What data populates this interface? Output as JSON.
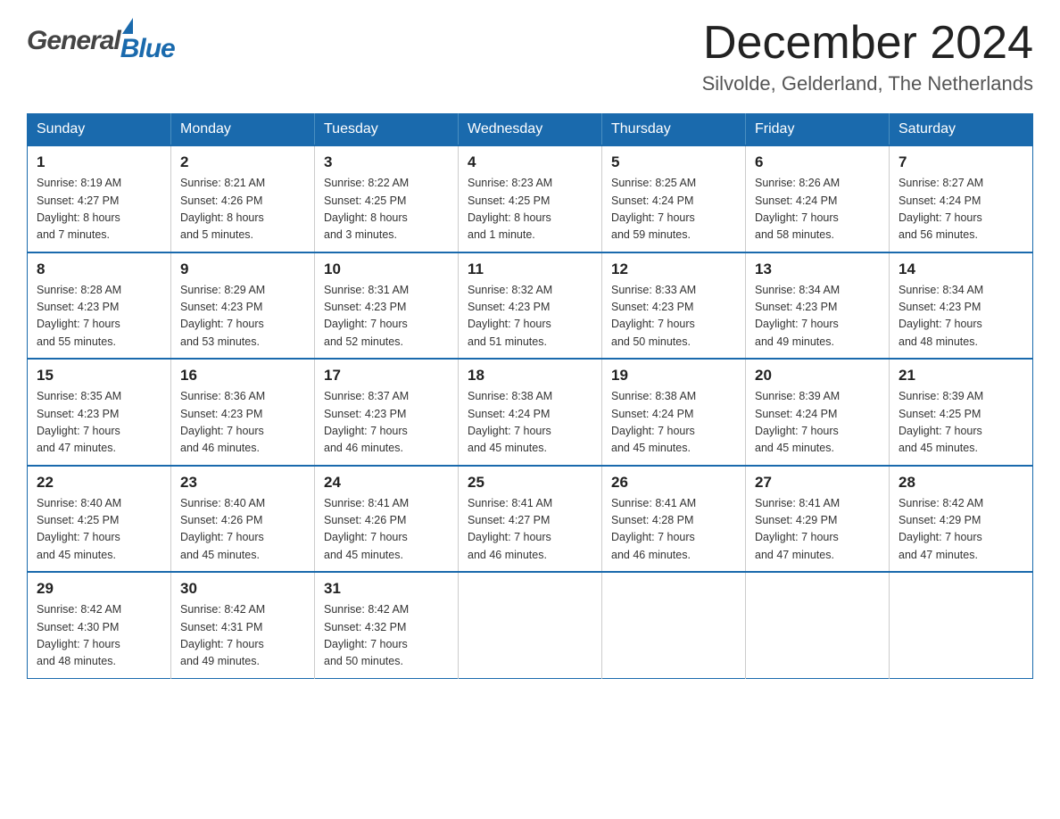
{
  "header": {
    "logo_general": "General",
    "logo_blue": "Blue",
    "month_title": "December 2024",
    "location": "Silvolde, Gelderland, The Netherlands"
  },
  "weekdays": [
    "Sunday",
    "Monday",
    "Tuesday",
    "Wednesday",
    "Thursday",
    "Friday",
    "Saturday"
  ],
  "weeks": [
    [
      {
        "day": "1",
        "sunrise": "8:19 AM",
        "sunset": "4:27 PM",
        "daylight": "8 hours and 7 minutes."
      },
      {
        "day": "2",
        "sunrise": "8:21 AM",
        "sunset": "4:26 PM",
        "daylight": "8 hours and 5 minutes."
      },
      {
        "day": "3",
        "sunrise": "8:22 AM",
        "sunset": "4:25 PM",
        "daylight": "8 hours and 3 minutes."
      },
      {
        "day": "4",
        "sunrise": "8:23 AM",
        "sunset": "4:25 PM",
        "daylight": "8 hours and 1 minute."
      },
      {
        "day": "5",
        "sunrise": "8:25 AM",
        "sunset": "4:24 PM",
        "daylight": "7 hours and 59 minutes."
      },
      {
        "day": "6",
        "sunrise": "8:26 AM",
        "sunset": "4:24 PM",
        "daylight": "7 hours and 58 minutes."
      },
      {
        "day": "7",
        "sunrise": "8:27 AM",
        "sunset": "4:24 PM",
        "daylight": "7 hours and 56 minutes."
      }
    ],
    [
      {
        "day": "8",
        "sunrise": "8:28 AM",
        "sunset": "4:23 PM",
        "daylight": "7 hours and 55 minutes."
      },
      {
        "day": "9",
        "sunrise": "8:29 AM",
        "sunset": "4:23 PM",
        "daylight": "7 hours and 53 minutes."
      },
      {
        "day": "10",
        "sunrise": "8:31 AM",
        "sunset": "4:23 PM",
        "daylight": "7 hours and 52 minutes."
      },
      {
        "day": "11",
        "sunrise": "8:32 AM",
        "sunset": "4:23 PM",
        "daylight": "7 hours and 51 minutes."
      },
      {
        "day": "12",
        "sunrise": "8:33 AM",
        "sunset": "4:23 PM",
        "daylight": "7 hours and 50 minutes."
      },
      {
        "day": "13",
        "sunrise": "8:34 AM",
        "sunset": "4:23 PM",
        "daylight": "7 hours and 49 minutes."
      },
      {
        "day": "14",
        "sunrise": "8:34 AM",
        "sunset": "4:23 PM",
        "daylight": "7 hours and 48 minutes."
      }
    ],
    [
      {
        "day": "15",
        "sunrise": "8:35 AM",
        "sunset": "4:23 PM",
        "daylight": "7 hours and 47 minutes."
      },
      {
        "day": "16",
        "sunrise": "8:36 AM",
        "sunset": "4:23 PM",
        "daylight": "7 hours and 46 minutes."
      },
      {
        "day": "17",
        "sunrise": "8:37 AM",
        "sunset": "4:23 PM",
        "daylight": "7 hours and 46 minutes."
      },
      {
        "day": "18",
        "sunrise": "8:38 AM",
        "sunset": "4:24 PM",
        "daylight": "7 hours and 45 minutes."
      },
      {
        "day": "19",
        "sunrise": "8:38 AM",
        "sunset": "4:24 PM",
        "daylight": "7 hours and 45 minutes."
      },
      {
        "day": "20",
        "sunrise": "8:39 AM",
        "sunset": "4:24 PM",
        "daylight": "7 hours and 45 minutes."
      },
      {
        "day": "21",
        "sunrise": "8:39 AM",
        "sunset": "4:25 PM",
        "daylight": "7 hours and 45 minutes."
      }
    ],
    [
      {
        "day": "22",
        "sunrise": "8:40 AM",
        "sunset": "4:25 PM",
        "daylight": "7 hours and 45 minutes."
      },
      {
        "day": "23",
        "sunrise": "8:40 AM",
        "sunset": "4:26 PM",
        "daylight": "7 hours and 45 minutes."
      },
      {
        "day": "24",
        "sunrise": "8:41 AM",
        "sunset": "4:26 PM",
        "daylight": "7 hours and 45 minutes."
      },
      {
        "day": "25",
        "sunrise": "8:41 AM",
        "sunset": "4:27 PM",
        "daylight": "7 hours and 46 minutes."
      },
      {
        "day": "26",
        "sunrise": "8:41 AM",
        "sunset": "4:28 PM",
        "daylight": "7 hours and 46 minutes."
      },
      {
        "day": "27",
        "sunrise": "8:41 AM",
        "sunset": "4:29 PM",
        "daylight": "7 hours and 47 minutes."
      },
      {
        "day": "28",
        "sunrise": "8:42 AM",
        "sunset": "4:29 PM",
        "daylight": "7 hours and 47 minutes."
      }
    ],
    [
      {
        "day": "29",
        "sunrise": "8:42 AM",
        "sunset": "4:30 PM",
        "daylight": "7 hours and 48 minutes."
      },
      {
        "day": "30",
        "sunrise": "8:42 AM",
        "sunset": "4:31 PM",
        "daylight": "7 hours and 49 minutes."
      },
      {
        "day": "31",
        "sunrise": "8:42 AM",
        "sunset": "4:32 PM",
        "daylight": "7 hours and 50 minutes."
      },
      null,
      null,
      null,
      null
    ]
  ],
  "labels": {
    "sunrise": "Sunrise:",
    "sunset": "Sunset:",
    "daylight": "Daylight:"
  }
}
